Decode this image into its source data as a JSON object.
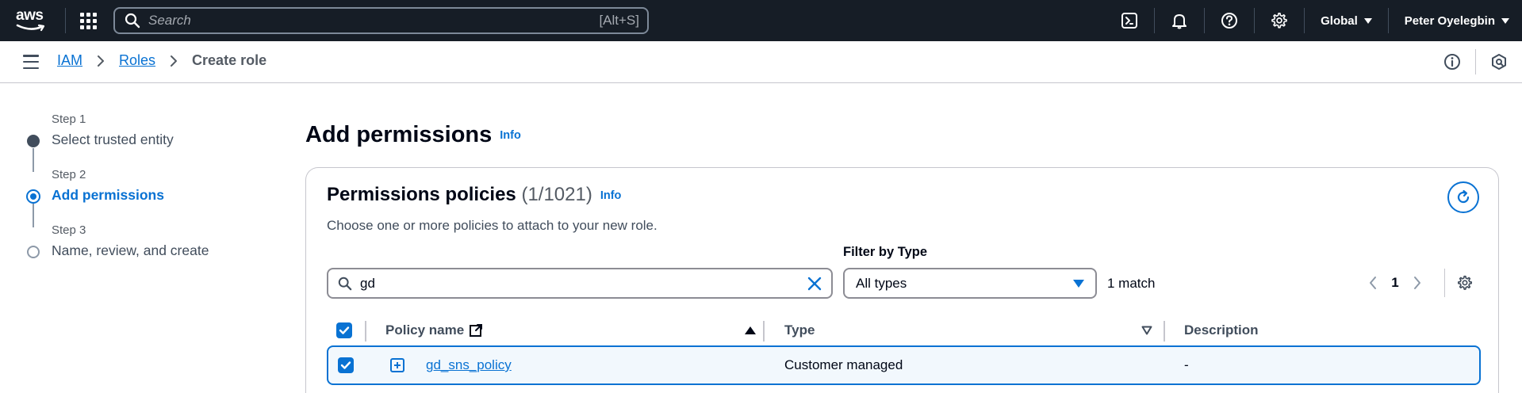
{
  "topnav": {
    "logo_text": "aws",
    "search_placeholder": "Search",
    "search_shortcut": "[Alt+S]",
    "region": "Global",
    "user": "Peter Oyelegbin",
    "icons": [
      "cloudshell-icon",
      "bell-icon",
      "help-icon",
      "gear-icon"
    ]
  },
  "breadcrumb": {
    "items": [
      {
        "label": "IAM"
      },
      {
        "label": "Roles"
      }
    ],
    "current": "Create role"
  },
  "steps": [
    {
      "num": "Step 1",
      "title": "Select trusted entity",
      "state": "done"
    },
    {
      "num": "Step 2",
      "title": "Add permissions",
      "state": "current"
    },
    {
      "num": "Step 3",
      "title": "Name, review, and create",
      "state": "todo"
    }
  ],
  "page": {
    "title": "Add permissions",
    "info": "Info"
  },
  "policies": {
    "title": "Permissions policies",
    "count": "(1/1021)",
    "info": "Info",
    "description": "Choose one or more policies to attach to your new role.",
    "search_value": "gd",
    "filter_label": "Filter by Type",
    "filter_value": "All types",
    "match_count": "1 match",
    "page_number": "1",
    "columns": {
      "name": "Policy name",
      "type": "Type",
      "description": "Description"
    },
    "rows": [
      {
        "name": "gd_sns_policy",
        "type": "Customer managed",
        "description": "-",
        "selected": true
      }
    ]
  },
  "colors": {
    "nav_bg": "#161d26",
    "accent": "#0972d3",
    "text": "#000716",
    "muted": "#414d5c"
  }
}
